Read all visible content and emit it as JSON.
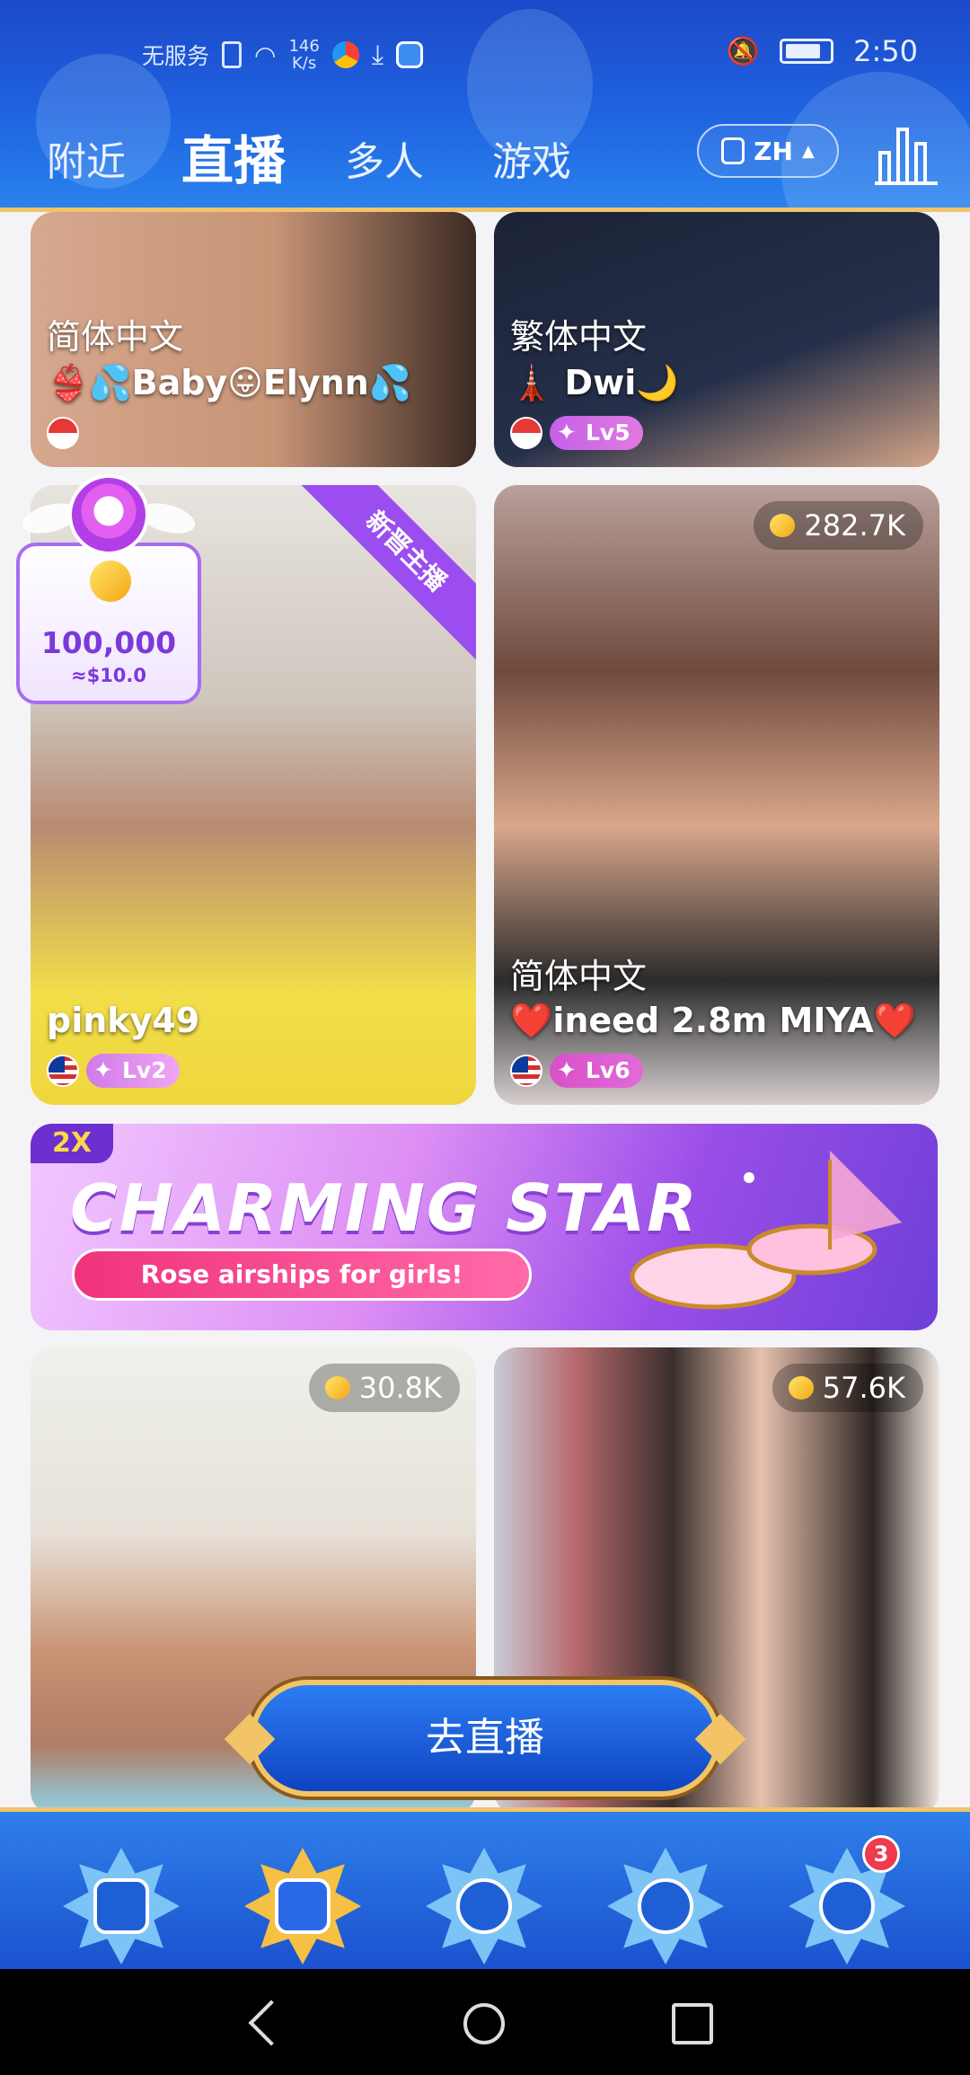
{
  "status_bar": {
    "carrier": "无服务",
    "speed_value": "146",
    "speed_unit": "K/s",
    "time": "2:50"
  },
  "tabs": [
    {
      "label": "附近"
    },
    {
      "label": "直播"
    },
    {
      "label": "多人"
    },
    {
      "label": "游戏"
    }
  ],
  "language_button": {
    "label": "ZH"
  },
  "streams": [
    {
      "language": "简体中文",
      "name": "👙💦Baby😛Elynn💦",
      "country": "SG"
    },
    {
      "language": "繁体中文",
      "name": "🗼 Dwi🌙",
      "country": "ID",
      "level": "Lv5"
    },
    {
      "corner_tag": "新晋主播",
      "name": "pinky49",
      "country": "MY",
      "level": "Lv2"
    },
    {
      "viewers": "282.7K",
      "language": "简体中文",
      "name": "❤️ineed 2.8m  MIYA❤️",
      "country": "MY",
      "level": "Lv6"
    },
    {
      "viewers": "30.8K"
    },
    {
      "viewers": "57.6K"
    }
  ],
  "reward_popup": {
    "amount": "100,000",
    "usd": "≈$10.0"
  },
  "banner": {
    "multiplier": "2X",
    "title": "CHARMING STAR",
    "subtitle": "Rose airships for girls!"
  },
  "go_live_button": {
    "label": "去直播"
  },
  "bottom_nav": {
    "items": [
      {
        "icon": "camera-moon-icon"
      },
      {
        "icon": "live-tv-icon"
      },
      {
        "icon": "party-users-icon"
      },
      {
        "icon": "planet-icon"
      },
      {
        "icon": "profile-icon",
        "badge": "3"
      }
    ]
  },
  "colors": {
    "header_blue": "#1f63e0",
    "gold_border": "#f1c46a",
    "level_purple": "#b56af2",
    "level_pink": "#e05fd0",
    "badge_red": "#f03a4d"
  }
}
